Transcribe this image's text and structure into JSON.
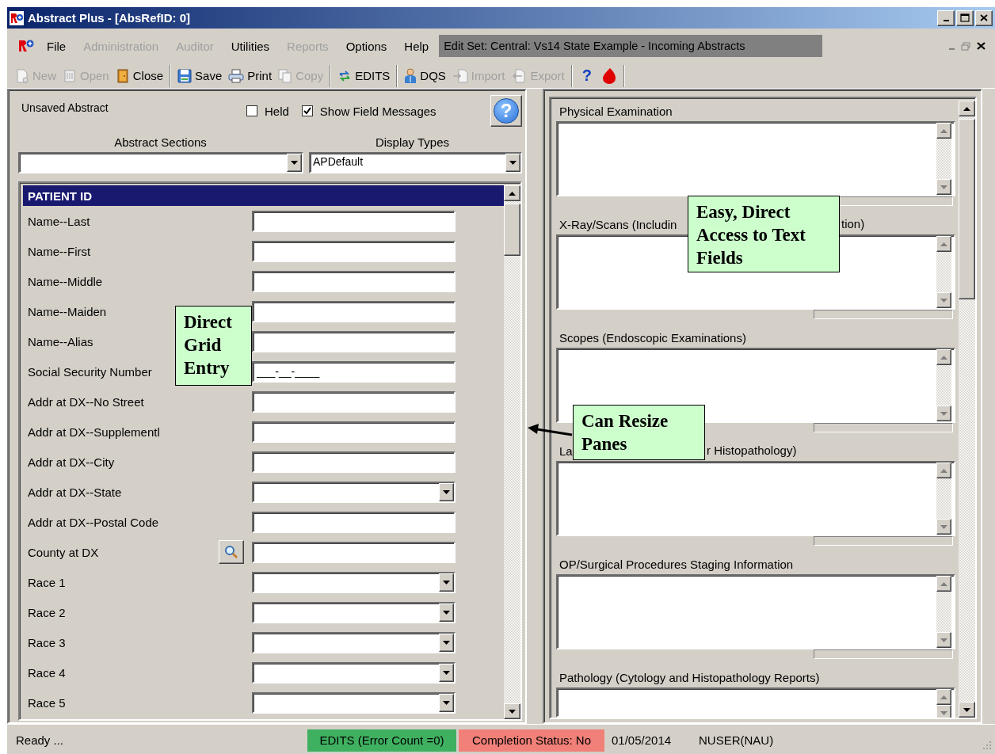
{
  "window": {
    "title": "Abstract Plus - [AbsRefID: 0]"
  },
  "menu": {
    "items": [
      {
        "label": "File",
        "disabled": false
      },
      {
        "label": "Administration",
        "disabled": true
      },
      {
        "label": "Auditor",
        "disabled": true
      },
      {
        "label": "Utilities",
        "disabled": false
      },
      {
        "label": "Reports",
        "disabled": true
      },
      {
        "label": "Options",
        "disabled": false
      },
      {
        "label": "Help",
        "disabled": false
      }
    ],
    "edit_set": "Edit Set: Central: Vs14 State Example - Incoming Abstracts"
  },
  "toolbar": [
    {
      "kind": "new",
      "label": "New",
      "disabled": true
    },
    {
      "kind": "open",
      "label": "Open",
      "disabled": true
    },
    {
      "kind": "close",
      "label": "Close",
      "disabled": false
    },
    {
      "kind": "separator"
    },
    {
      "kind": "save",
      "label": "Save",
      "disabled": false
    },
    {
      "kind": "print",
      "label": "Print",
      "disabled": false
    },
    {
      "kind": "copy",
      "label": "Copy",
      "disabled": true
    },
    {
      "kind": "separator"
    },
    {
      "kind": "edits",
      "label": "EDITS",
      "disabled": false
    },
    {
      "kind": "separator"
    },
    {
      "kind": "dqs",
      "label": "DQS",
      "disabled": false
    },
    {
      "kind": "import",
      "label": "Import",
      "disabled": true
    },
    {
      "kind": "export",
      "label": "Export",
      "disabled": true
    },
    {
      "kind": "separator"
    },
    {
      "kind": "help",
      "label": "?",
      "disabled": false
    },
    {
      "kind": "drop",
      "disabled": false
    },
    {
      "kind": "separator"
    }
  ],
  "abstract": {
    "status": "Unsaved Abstract",
    "held": {
      "label": "Held",
      "checked": false
    },
    "show_messages": {
      "label": "Show Field Messages",
      "checked": true
    },
    "help_label": "?",
    "sections_label": "Abstract Sections",
    "display_label": "Display Types",
    "display_value": "APDefault"
  },
  "grid": {
    "header": "PATIENT ID",
    "rows": [
      {
        "label": "Name--Last",
        "kind": "text"
      },
      {
        "label": "Name--First",
        "kind": "text"
      },
      {
        "label": "Name--Middle",
        "kind": "text"
      },
      {
        "label": "Name--Maiden",
        "kind": "text"
      },
      {
        "label": "Name--Alias",
        "kind": "text"
      },
      {
        "label": "Social Security Number",
        "kind": "text",
        "value": "___-__-____"
      },
      {
        "label": "Addr at DX--No  Street",
        "kind": "text"
      },
      {
        "label": "Addr at DX--Supplementl",
        "kind": "text"
      },
      {
        "label": "Addr at DX--City",
        "kind": "text"
      },
      {
        "label": "Addr at DX--State",
        "kind": "select"
      },
      {
        "label": "Addr at DX--Postal Code",
        "kind": "text"
      },
      {
        "label": "County at DX",
        "kind": "lookup"
      },
      {
        "label": "Race 1",
        "kind": "select"
      },
      {
        "label": "Race 2",
        "kind": "select"
      },
      {
        "label": "Race 3",
        "kind": "select"
      },
      {
        "label": "Race 4",
        "kind": "select"
      },
      {
        "label": "Race 5",
        "kind": "select"
      }
    ]
  },
  "text_sections": [
    {
      "label": "Physical Examination"
    },
    {
      "label": "X-Ray/Scans (Includin",
      "label_tail": "tion)"
    },
    {
      "label": "Scopes (Endoscopic Examinations)"
    },
    {
      "label": "La",
      "label_tail": "r Histopathology)"
    },
    {
      "label": "OP/Surgical Procedures Staging Information"
    },
    {
      "label": "Pathology (Cytology and Histopathology Reports)"
    }
  ],
  "callouts": [
    {
      "text": "Easy, Direct Access to Text Fields",
      "arrow": false
    },
    {
      "text": "Direct Grid Entry",
      "arrow": false
    },
    {
      "text": "Can Resize Panes",
      "arrow": true
    }
  ],
  "status_bar": {
    "text": "Ready ...",
    "edits": "EDITS (Error Count =0)",
    "completion": "Completion Status: No",
    "date": "01/05/2014",
    "user": "NUSER(NAU)"
  }
}
